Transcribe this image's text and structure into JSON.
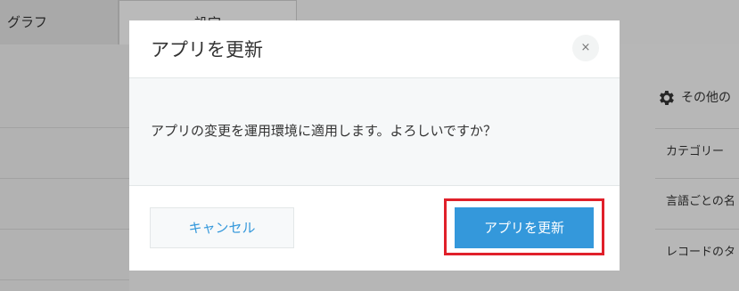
{
  "background": {
    "tabs": [
      {
        "label": "グラフ"
      },
      {
        "label": "設定"
      }
    ],
    "right_panel": {
      "heading": "その他の",
      "gear_icon": "gear-icon",
      "rows": [
        {
          "label": "カテゴリー"
        },
        {
          "label": "言語ごとの名"
        },
        {
          "label": "レコードのタ"
        }
      ]
    }
  },
  "dialog": {
    "title": "アプリを更新",
    "close_icon": "close-icon",
    "close_glyph": "×",
    "message": "アプリの変更を運用環境に適用します。よろしいですか？",
    "cancel_label": "キャンセル",
    "confirm_label": "アプリを更新",
    "highlight_color": "#e0202a",
    "accent_color": "#3498db"
  }
}
